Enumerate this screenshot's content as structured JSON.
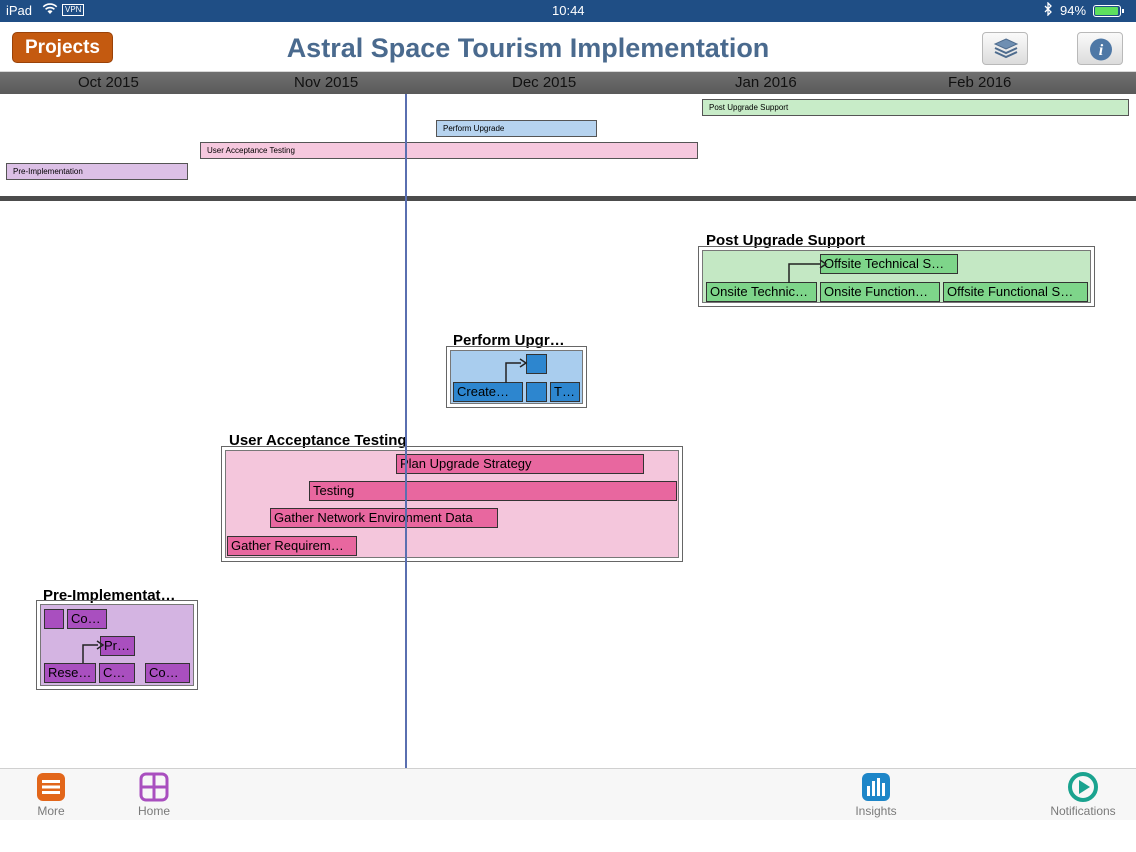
{
  "status": {
    "device": "iPad",
    "network": "VPN",
    "time": "10:44",
    "battery": "94%",
    "battery_level": 0.94
  },
  "nav": {
    "projects_label": "Projects",
    "title": "Astral Space Tourism Implementation"
  },
  "months": [
    "Oct 2015",
    "Nov 2015",
    "Dec 2015",
    "Jan 2016",
    "Feb 2016"
  ],
  "gantt": [
    {
      "label": "Post Upgrade Support",
      "color": "#c8ecc8"
    },
    {
      "label": "Perform Upgrade",
      "color": "#b6d3ef"
    },
    {
      "label": "User Acceptance Testing",
      "color": "#f6c8de"
    },
    {
      "label": "Pre-Implementation",
      "color": "#dcc0e6"
    }
  ],
  "phases": {
    "post_upgrade": {
      "title": "Post Upgrade Support",
      "tasks": [
        "Offsite Technical S…",
        "Onsite Technic…",
        "Onsite Function…",
        "Offsite Functional S…"
      ]
    },
    "perform_upgrade": {
      "title": "Perform Upgr…",
      "tasks": [
        "Create…",
        "T…"
      ]
    },
    "uat": {
      "title": "User Acceptance Testing",
      "tasks": [
        "Plan Upgrade Strategy",
        "Testing",
        "Gather Network Environment Data",
        "Gather Requirem…"
      ]
    },
    "pre_impl": {
      "title": "Pre-Implementat…",
      "tasks": [
        "Co…",
        "Pr…",
        "Rese…",
        "C…",
        "Co…"
      ]
    }
  },
  "tabs": [
    "More",
    "Home",
    "Insights",
    "Notifications"
  ],
  "colors": {
    "accent": "#c45a10",
    "status_bar": "#1f4e85",
    "title": "#4a6a8e",
    "tab_more": "#e2661a",
    "tab_home": "#a94fbf",
    "tab_insights": "#1e86c8",
    "tab_notifications": "#1aa38f"
  }
}
